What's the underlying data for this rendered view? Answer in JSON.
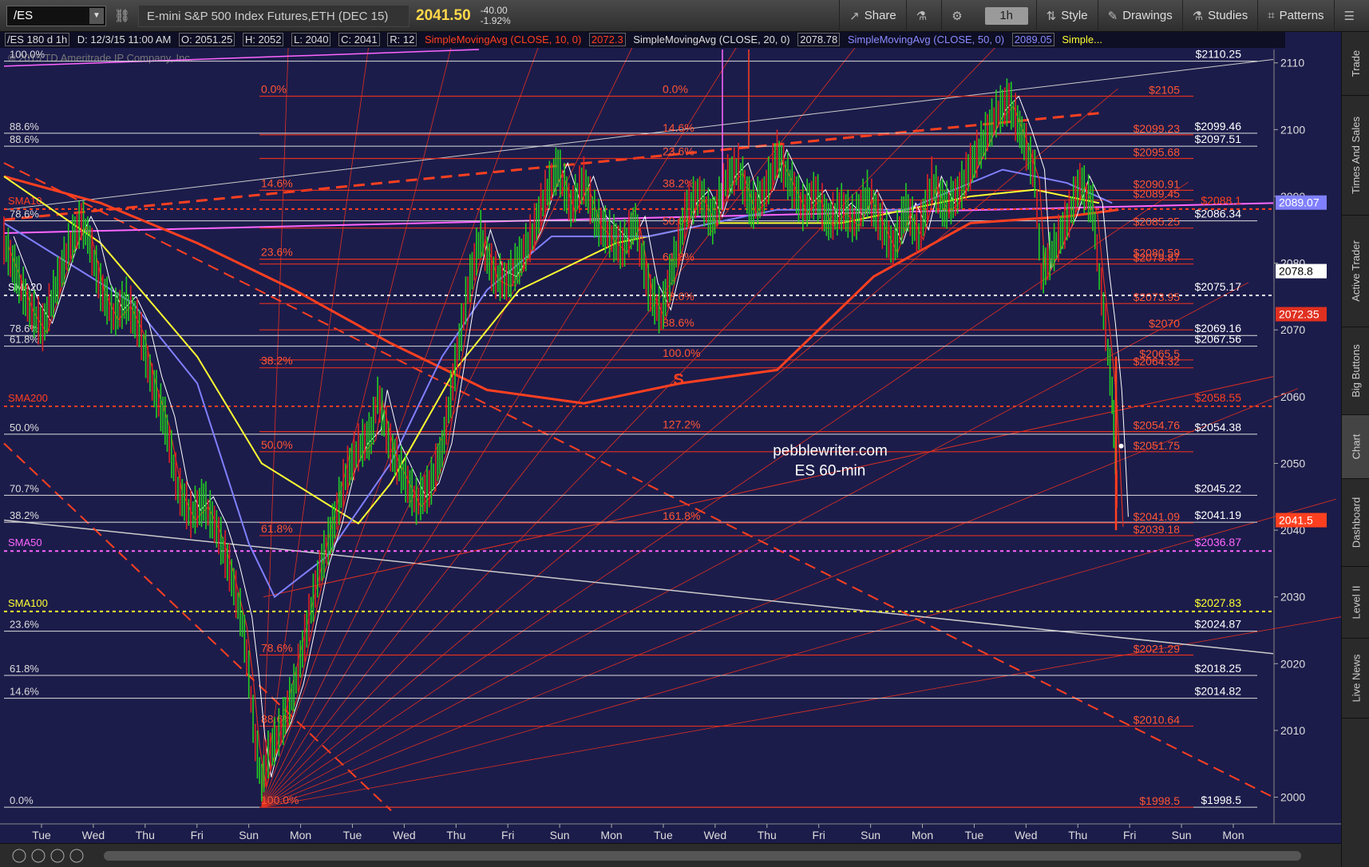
{
  "toolbar": {
    "symbol": "/ES",
    "description": "E-mini S&P 500 Index Futures,ETH (DEC 15)",
    "last_price": "2041.50",
    "change": "-40.00",
    "change_pct": "-1.92%",
    "share": "Share",
    "timeframe": "1h",
    "style": "Style",
    "drawings": "Drawings",
    "studies": "Studies",
    "patterns": "Patterns"
  },
  "infobar": {
    "symbol_period": "/ES 180 d 1h",
    "date": "D: 12/3/15 11:00 AM",
    "open": "O: 2051.25",
    "high": "H: 2052",
    "low": "L: 2040",
    "close": "C: 2041",
    "range": "R: 12",
    "sma10_label": "SimpleMovingAvg (CLOSE, 10, 0)",
    "sma10_value": "2072.3",
    "sma20_label": "SimpleMovingAvg (CLOSE, 20, 0)",
    "sma20_value": "2078.78",
    "sma50_label": "SimpleMovingAvg (CLOSE, 50, 0)",
    "sma50_value": "2089.05",
    "more": "Simple..."
  },
  "side_tabs": [
    "Trade",
    "Times And Sales",
    "Active Trader",
    "Big Buttons",
    "Chart",
    "Dashboard",
    "Level II",
    "Live News"
  ],
  "watermark": "© 2015 TD Ameritrade IP Company, Inc.",
  "annotation": {
    "line1": "pebblewriter.com",
    "line2": "ES 60-min",
    "pattern_mark": "S"
  },
  "chart_data": {
    "type": "line",
    "title": "",
    "ylim": [
      1996,
      2112
    ],
    "y_ticks": [
      2000,
      2010,
      2020,
      2030,
      2040,
      2050,
      2060,
      2070,
      2080,
      2090,
      2100,
      2110
    ],
    "x_labels": [
      "Tue",
      "Wed",
      "Thu",
      "Fri",
      "Sun",
      "Mon",
      "Tue",
      "Wed",
      "Thu",
      "Fri",
      "Sun",
      "Mon",
      "Tue",
      "Wed",
      "Thu",
      "Fri",
      "Sun",
      "Mon",
      "Tue",
      "Wed",
      "Thu",
      "Fri",
      "Sun",
      "Mon"
    ],
    "price_badges": [
      {
        "value": "2089.07",
        "color": "#8080ff"
      },
      {
        "value": "2078.8",
        "color": "#ffffff"
      },
      {
        "value": "2072.35",
        "color": "#e03020"
      },
      {
        "value": "2041.5",
        "color": "#ff4020"
      }
    ],
    "horizontal_levels_white": [
      {
        "price": 2110.25,
        "left_label": "100.0%",
        "right_label": "$2110.25"
      },
      {
        "price": 2099.46,
        "left_label": "88.6%",
        "right_label": "$2099.46"
      },
      {
        "price": 2097.51,
        "left_label": "88.6%",
        "right_label": "$2097.51"
      },
      {
        "price": 2086.34,
        "left_label": "78.6%",
        "right_label": "$2086.34"
      },
      {
        "price": 2069.16,
        "left_label": "78.6%",
        "right_label": "$2069.16"
      },
      {
        "price": 2067.56,
        "left_label": "61.8%",
        "right_label": "$2067.56"
      },
      {
        "price": 2054.38,
        "left_label": "50.0%",
        "right_label": "$2054.38"
      },
      {
        "price": 2045.22,
        "left_label": "70.7%",
        "right_label": "$2045.22"
      },
      {
        "price": 2041.19,
        "left_label": "38.2%",
        "right_label": "$2041.19"
      },
      {
        "price": 2024.87,
        "left_label": "23.6%",
        "right_label": "$2024.87"
      },
      {
        "price": 2018.25,
        "left_label": "61.8%",
        "right_label": "$2018.25"
      },
      {
        "price": 2014.82,
        "left_label": "14.6%",
        "right_label": "$2014.82"
      },
      {
        "price": 1998.5,
        "left_label": "0.0%",
        "right_label": "$1998.5"
      }
    ],
    "sma_levels": [
      {
        "name": "SMA10",
        "price": 2088.1,
        "color": "#ff4020",
        "right_label": "$2088.1"
      },
      {
        "name": "SMA20",
        "price": 2075.17,
        "color": "#ffffff",
        "right_label": "$2075.17"
      },
      {
        "name": "SMA200",
        "price": 2058.55,
        "color": "#ff4020",
        "right_label": "$2058.55"
      },
      {
        "name": "SMA50",
        "price": 2036.87,
        "color": "#ff66ff",
        "right_label": "$2036.87"
      },
      {
        "name": "SMA100",
        "price": 2027.83,
        "color": "#ffff33",
        "right_label": "$2027.83"
      }
    ],
    "fib_right_levels": [
      {
        "price": 2105,
        "label": "$2105"
      },
      {
        "price": 2099.23,
        "label": "$2099.23"
      },
      {
        "price": 2095.68,
        "label": "$2095.68"
      },
      {
        "price": 2090.91,
        "label": "$2090.91"
      },
      {
        "price": 2089.45,
        "label": "$2089.45"
      },
      {
        "price": 2085.25,
        "label": "$2085.25"
      },
      {
        "price": 2080.59,
        "label": "$2080.59"
      },
      {
        "price": 2079.87,
        "label": "$2079.87"
      },
      {
        "price": 2073.95,
        "label": "$2073.95"
      },
      {
        "price": 2070,
        "label": "$2070"
      },
      {
        "price": 2065.5,
        "label": "$2065.5"
      },
      {
        "price": 2064.32,
        "label": "$2064.32"
      },
      {
        "price": 2054.76,
        "label": "$2054.76"
      },
      {
        "price": 2051.75,
        "label": "$2051.75"
      },
      {
        "price": 2041.09,
        "label": "$2041.09"
      },
      {
        "price": 2039.18,
        "label": "$2039.18"
      },
      {
        "price": 2021.29,
        "label": "$2021.29"
      },
      {
        "price": 2010.64,
        "label": "$2010.64"
      },
      {
        "price": 1998.5,
        "label": "$1998.5"
      }
    ],
    "fib_mid_labels": [
      {
        "price": 2105,
        "label": "0.0%",
        "pos": "left"
      },
      {
        "price": 2090.91,
        "label": "14.6%",
        "pos": "left"
      },
      {
        "price": 2080.59,
        "label": "23.6%",
        "pos": "left"
      },
      {
        "price": 2064.32,
        "label": "38.2%",
        "pos": "left"
      },
      {
        "price": 2051.75,
        "label": "50.0%",
        "pos": "left"
      },
      {
        "price": 2039.18,
        "label": "61.8%",
        "pos": "left"
      },
      {
        "price": 2021.29,
        "label": "78.6%",
        "pos": "left"
      },
      {
        "price": 2010.64,
        "label": "88.6%",
        "pos": "left"
      },
      {
        "price": 1998.5,
        "label": "100.0%",
        "pos": "left"
      },
      {
        "price": 2105,
        "label": "0.0%",
        "pos": "mid"
      },
      {
        "price": 2099.23,
        "label": "14.6%",
        "pos": "mid"
      },
      {
        "price": 2095.68,
        "label": "23.6%",
        "pos": "mid"
      },
      {
        "price": 2090.91,
        "label": "38.2%",
        "pos": "mid"
      },
      {
        "price": 2085.25,
        "label": "50.0%",
        "pos": "mid"
      },
      {
        "price": 2079.87,
        "label": "61.8%",
        "pos": "mid"
      },
      {
        "price": 2073.95,
        "label": "78.6%",
        "pos": "mid"
      },
      {
        "price": 2070,
        "label": "88.6%",
        "pos": "mid"
      },
      {
        "price": 2065.5,
        "label": "100.0%",
        "pos": "mid"
      },
      {
        "price": 2054.76,
        "label": "127.2%",
        "pos": "mid"
      },
      {
        "price": 2041.09,
        "label": "161.8%",
        "pos": "mid"
      }
    ],
    "price_path": [
      [
        0,
        2083
      ],
      [
        2,
        2078
      ],
      [
        4,
        2073
      ],
      [
        6,
        2070
      ],
      [
        8,
        2076
      ],
      [
        10,
        2082
      ],
      [
        12,
        2086
      ],
      [
        13,
        2084
      ],
      [
        15,
        2076
      ],
      [
        17,
        2072
      ],
      [
        19,
        2074
      ],
      [
        21,
        2070
      ],
      [
        23,
        2062
      ],
      [
        25,
        2056
      ],
      [
        27,
        2046
      ],
      [
        29,
        2042
      ],
      [
        31,
        2044
      ],
      [
        33,
        2040
      ],
      [
        35,
        2034
      ],
      [
        37,
        2026
      ],
      [
        38,
        2018
      ],
      [
        39,
        2008
      ],
      [
        40,
        2002
      ],
      [
        41,
        2006
      ],
      [
        43,
        2010
      ],
      [
        45,
        2016
      ],
      [
        47,
        2025
      ],
      [
        49,
        2034
      ],
      [
        51,
        2040
      ],
      [
        53,
        2048
      ],
      [
        55,
        2052
      ],
      [
        57,
        2054
      ],
      [
        58,
        2060
      ],
      [
        60,
        2052
      ],
      [
        62,
        2048
      ],
      [
        64,
        2044
      ],
      [
        66,
        2046
      ],
      [
        68,
        2052
      ],
      [
        70,
        2064
      ],
      [
        72,
        2076
      ],
      [
        74,
        2084
      ],
      [
        76,
        2078
      ],
      [
        78,
        2077
      ],
      [
        80,
        2080
      ],
      [
        82,
        2084
      ],
      [
        84,
        2090
      ],
      [
        86,
        2094
      ],
      [
        88,
        2088
      ],
      [
        90,
        2092
      ],
      [
        92,
        2086
      ],
      [
        94,
        2084
      ],
      [
        96,
        2082
      ],
      [
        98,
        2086
      ],
      [
        100,
        2076
      ],
      [
        102,
        2072
      ],
      [
        104,
        2080
      ],
      [
        106,
        2088
      ],
      [
        108,
        2090
      ],
      [
        110,
        2086
      ],
      [
        112,
        2092
      ],
      [
        114,
        2094
      ],
      [
        116,
        2088
      ],
      [
        118,
        2090
      ],
      [
        120,
        2096
      ],
      [
        122,
        2092
      ],
      [
        124,
        2088
      ],
      [
        126,
        2090
      ],
      [
        128,
        2086
      ],
      [
        130,
        2088
      ],
      [
        132,
        2086
      ],
      [
        134,
        2090
      ],
      [
        136,
        2086
      ],
      [
        138,
        2082
      ],
      [
        140,
        2088
      ],
      [
        142,
        2084
      ],
      [
        144,
        2092
      ],
      [
        146,
        2088
      ],
      [
        148,
        2090
      ],
      [
        150,
        2094
      ],
      [
        152,
        2098
      ],
      [
        154,
        2102
      ],
      [
        156,
        2104
      ],
      [
        158,
        2099
      ],
      [
        160,
        2093
      ],
      [
        161,
        2078
      ],
      [
        163,
        2082
      ],
      [
        165,
        2086
      ],
      [
        167,
        2092
      ],
      [
        169,
        2088
      ],
      [
        170,
        2078
      ],
      [
        171,
        2070
      ],
      [
        172,
        2060
      ],
      [
        172.5,
        2051
      ],
      [
        173,
        2041
      ]
    ],
    "x_max": 197
  }
}
